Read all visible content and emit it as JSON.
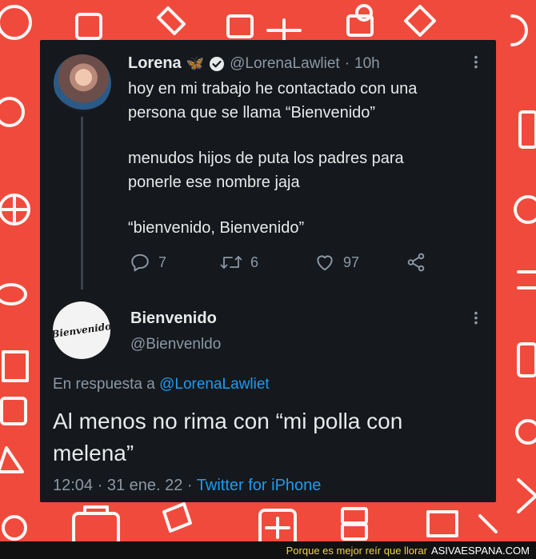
{
  "tweet": {
    "author_name": "Lorena",
    "author_emoji": "🦋",
    "handle": "@LorenaLawliet",
    "time": "10h",
    "text_lines": [
      "hoy en mi trabajo he contactado con una",
      "persona que se llama “Bienvenido”",
      "menudos hijos de puta los padres para",
      "ponerle ese nombre jaja",
      "“bienvenido, Bienvenido”"
    ],
    "replies": "7",
    "retweets": "6",
    "likes": "97"
  },
  "reply": {
    "author_name": "Bienvenido",
    "handle": "@Bienvenldo",
    "avatar_text": "Bienvenido",
    "in_reply_to_prefix": "En respuesta a",
    "in_reply_to_handle": "@LorenaLawliet",
    "text": "Al menos no rima con “mi polla con melena”",
    "timestamp": "12:04 · 31 ene. 22 ·",
    "client": "Twitter for iPhone"
  },
  "footer": {
    "tagline": "Porque es mejor reír que llorar",
    "site": "ASIVAESPANA.COM"
  },
  "colors": {
    "background": "#f04a3c",
    "card": "#15181c",
    "text": "#e7e9ea",
    "muted": "#8b98a5",
    "link": "#1d9bf0",
    "verified": "#e7e9ea"
  }
}
